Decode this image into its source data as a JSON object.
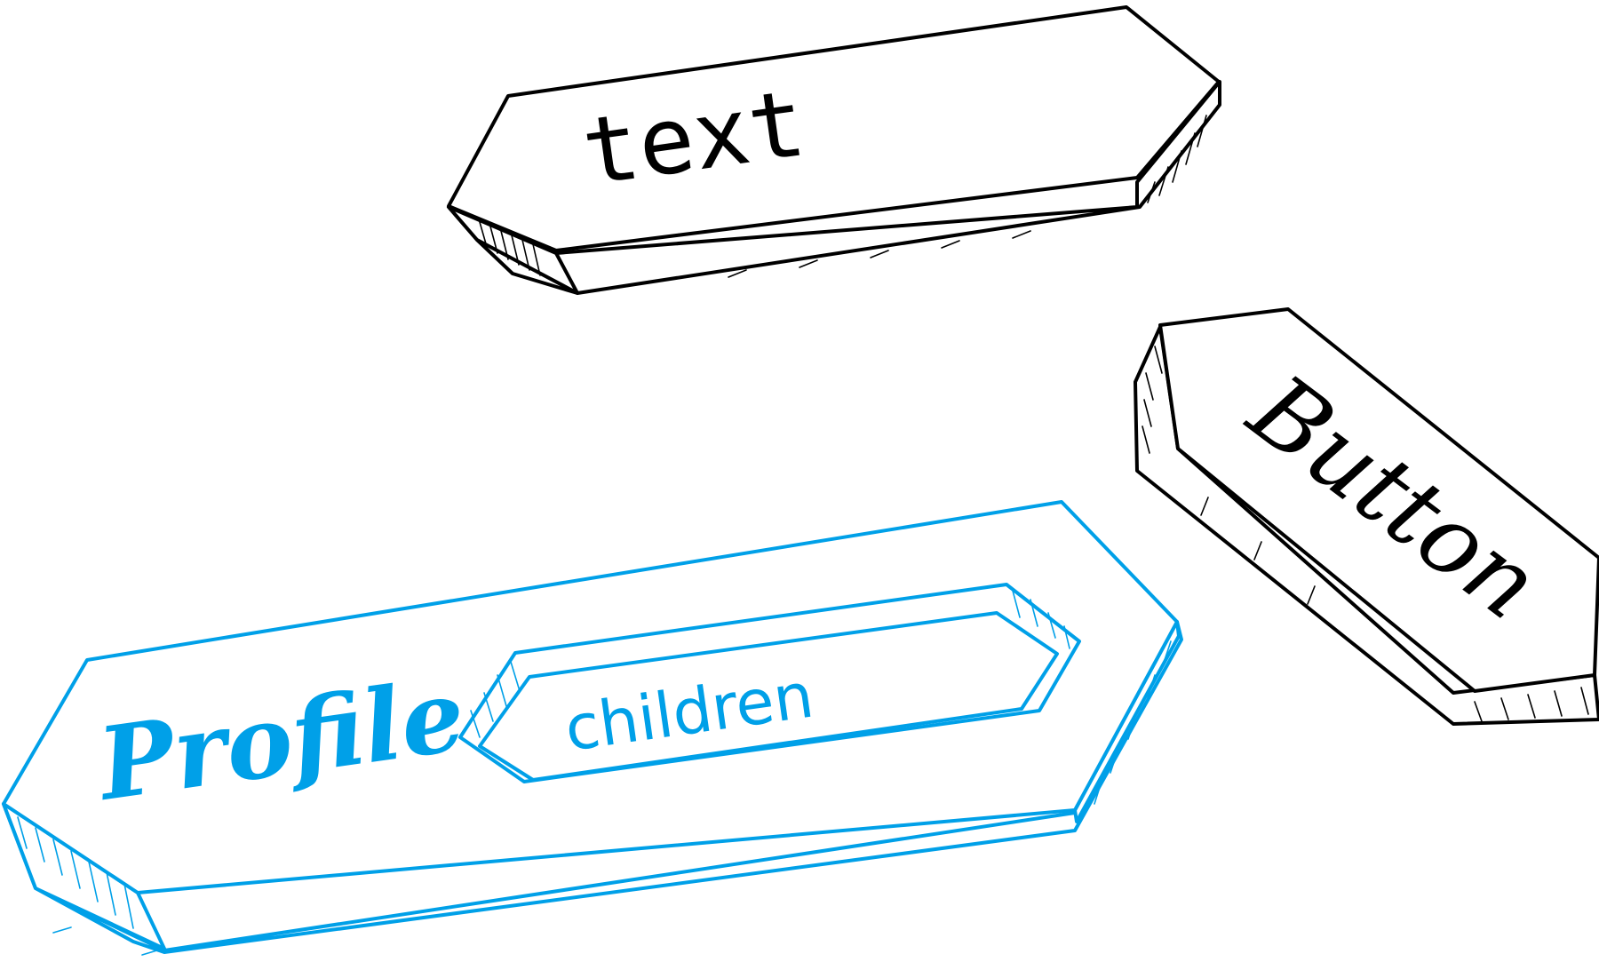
{
  "blocks": {
    "text_block": {
      "label": "text"
    },
    "button_block": {
      "label": "Button"
    },
    "profile_block": {
      "label": "Profile"
    },
    "children_slot": {
      "label": "children"
    }
  },
  "colors": {
    "ink": "#000000",
    "accent": "#00a0e8",
    "background": "#ffffff"
  }
}
